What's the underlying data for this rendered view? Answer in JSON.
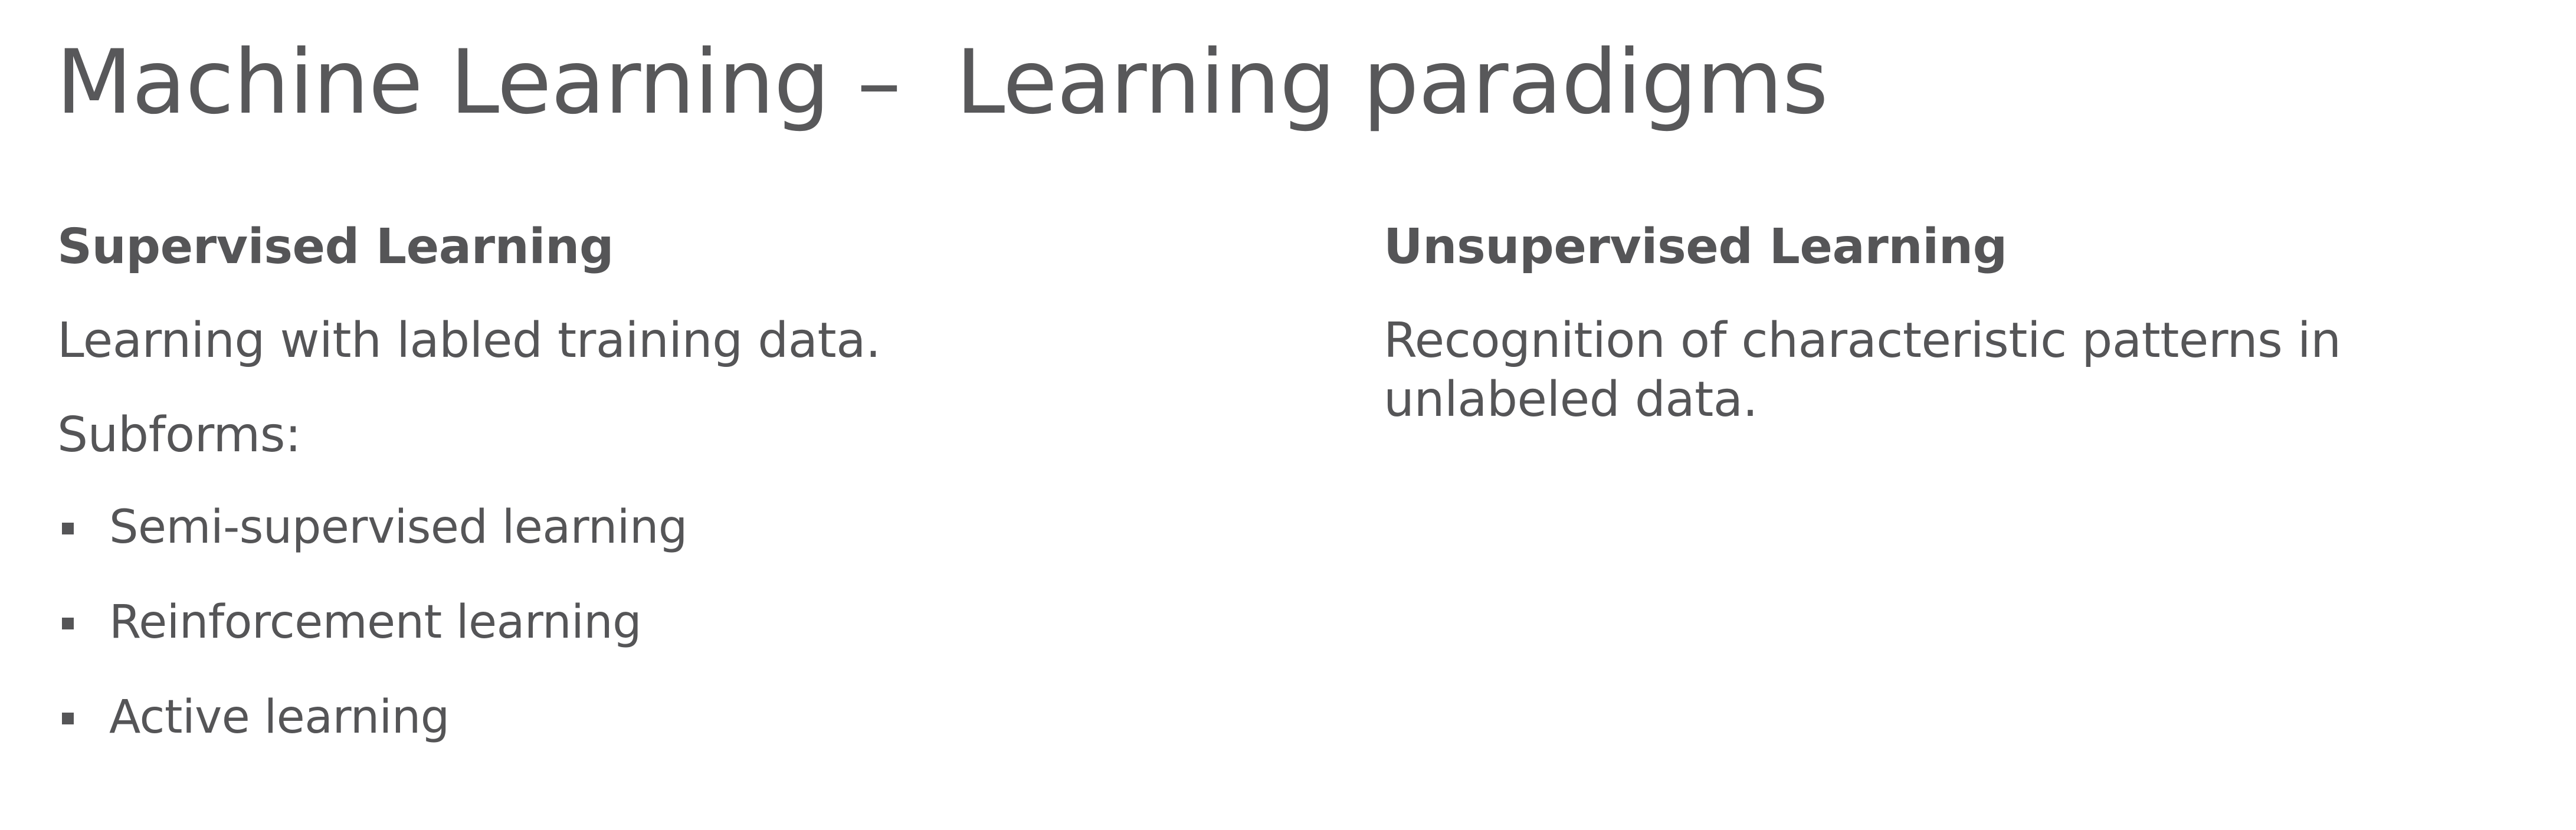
{
  "title": "Machine Learning –  Learning paradigms",
  "supervised": {
    "heading": "Supervised Learning",
    "description": "Learning with labled training data.",
    "subforms_label": "Subforms:",
    "subforms": [
      "Semi-supervised learning",
      "Reinforcement learning",
      "Active learning"
    ]
  },
  "unsupervised": {
    "heading": "Unsupervised Learning",
    "description": "Recognition of characteristic patterns in unlabeled data."
  }
}
